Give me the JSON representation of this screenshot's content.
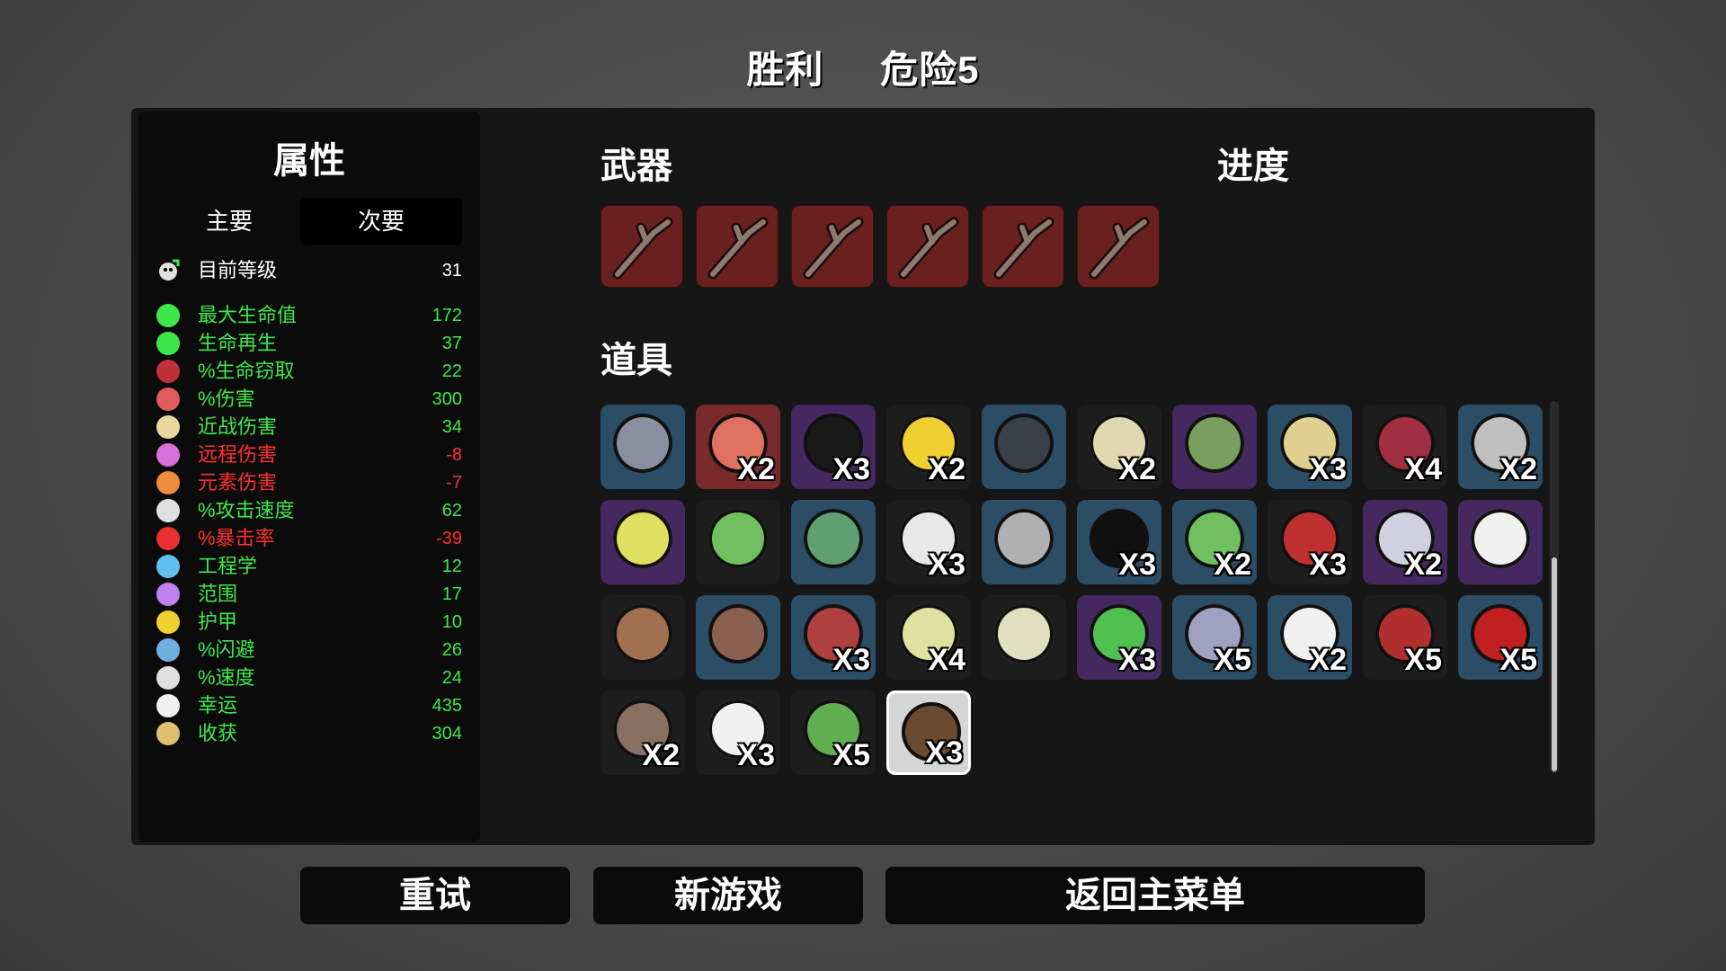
{
  "header": {
    "result": "胜利",
    "danger": "危险5"
  },
  "stats": {
    "title": "属性",
    "tabs": {
      "primary": "主要",
      "secondary": "次要"
    },
    "level": {
      "label": "目前等级",
      "value": "31"
    },
    "rows": [
      {
        "label": "最大生命值",
        "value": "172",
        "tone": "green",
        "icon": "heart-icon",
        "color": "#3fe84a"
      },
      {
        "label": "生命再生",
        "value": "37",
        "tone": "green",
        "icon": "heart-plus-icon",
        "color": "#3fe84a"
      },
      {
        "label": "%生命窃取",
        "value": "22",
        "tone": "green",
        "icon": "fangs-icon",
        "color": "#c0303a"
      },
      {
        "label": "%伤害",
        "value": "300",
        "tone": "green",
        "icon": "muscle-icon",
        "color": "#e05b5b"
      },
      {
        "label": "近战伤害",
        "value": "34",
        "tone": "green",
        "icon": "sword-icon",
        "color": "#e8d8a0"
      },
      {
        "label": "远程伤害",
        "value": "-8",
        "tone": "red",
        "icon": "bow-icon",
        "color": "#d870d8"
      },
      {
        "label": "元素伤害",
        "value": "-7",
        "tone": "red",
        "icon": "flame-icon",
        "color": "#f08a3c"
      },
      {
        "label": "%攻击速度",
        "value": "62",
        "tone": "green",
        "icon": "hourglass-icon",
        "color": "#e0e0e0"
      },
      {
        "label": "%暴击率",
        "value": "-39",
        "tone": "red",
        "icon": "crit-burst-icon",
        "color": "#e83030"
      },
      {
        "label": "工程学",
        "value": "12",
        "tone": "green",
        "icon": "wrench-icon",
        "color": "#60c0f0"
      },
      {
        "label": "范围",
        "value": "17",
        "tone": "green",
        "icon": "range-icon",
        "color": "#c080f0"
      },
      {
        "label": "护甲",
        "value": "10",
        "tone": "green",
        "icon": "shield-icon",
        "color": "#f0d030"
      },
      {
        "label": "%闪避",
        "value": "26",
        "tone": "green",
        "icon": "dodge-icon",
        "color": "#70b0e0"
      },
      {
        "label": "%速度",
        "value": "24",
        "tone": "green",
        "icon": "boot-icon",
        "color": "#e0e0e0"
      },
      {
        "label": "幸运",
        "value": "435",
        "tone": "green",
        "icon": "dice-icon",
        "color": "#f0f0f0"
      },
      {
        "label": "收获",
        "value": "304",
        "tone": "green",
        "icon": "wheat-icon",
        "color": "#e0c070"
      }
    ]
  },
  "weapons": {
    "title": "武器",
    "slots": [
      {
        "icon": "stick-icon"
      },
      {
        "icon": "stick-icon"
      },
      {
        "icon": "stick-icon"
      },
      {
        "icon": "stick-icon"
      },
      {
        "icon": "stick-icon"
      },
      {
        "icon": "stick-icon"
      }
    ]
  },
  "progress": {
    "title": "进度"
  },
  "items": {
    "title": "道具",
    "slots": [
      {
        "icon": "stone-ring-icon",
        "tier": "blue",
        "count": "",
        "color": "#8a8fa0"
      },
      {
        "icon": "octopus-icon",
        "tier": "red",
        "count": "X2",
        "color": "#e07060"
      },
      {
        "icon": "bowler-hat-icon",
        "tier": "purple",
        "count": "X3",
        "color": "#1a1a1a"
      },
      {
        "icon": "duck-icon",
        "tier": "black",
        "count": "X2",
        "color": "#f0d030"
      },
      {
        "icon": "jellyfish-robot-icon",
        "tier": "blue",
        "count": "",
        "color": "#3a3f4a"
      },
      {
        "icon": "scroll-icon",
        "tier": "black",
        "count": "X2",
        "color": "#e0d8b0"
      },
      {
        "icon": "tractor-icon",
        "tier": "purple",
        "count": "",
        "color": "#7aa060"
      },
      {
        "icon": "lasso-icon",
        "tier": "blue",
        "count": "X3",
        "color": "#e0d090"
      },
      {
        "icon": "serpent-icon",
        "tier": "black",
        "count": "X4",
        "color": "#a03040"
      },
      {
        "icon": "blade-icon",
        "tier": "blue",
        "count": "X2",
        "color": "#c0c0c0"
      },
      {
        "icon": "chemistry-set-icon",
        "tier": "purple",
        "count": "",
        "color": "#e0e060"
      },
      {
        "icon": "sprout-icon",
        "tier": "black",
        "count": "",
        "color": "#70c060"
      },
      {
        "icon": "machine-icon",
        "tier": "blue",
        "count": "",
        "color": "#60a070"
      },
      {
        "icon": "bandaged-head-icon",
        "tier": "black",
        "count": "X3",
        "color": "#e8e8e8"
      },
      {
        "icon": "factory-icon",
        "tier": "blue",
        "count": "",
        "color": "#b0b0b0"
      },
      {
        "icon": "black-orbs-icon",
        "tier": "blue",
        "count": "X3",
        "color": "#101010"
      },
      {
        "icon": "frog-icon",
        "tier": "blue",
        "count": "X2",
        "color": "#70c060"
      },
      {
        "icon": "red-lizard-icon",
        "tier": "black",
        "count": "X3",
        "color": "#c03030"
      },
      {
        "icon": "cannon-icon",
        "tier": "purple",
        "count": "X2",
        "color": "#d0d0e0"
      },
      {
        "icon": "ghost-cat-icon",
        "tier": "purple",
        "count": "",
        "color": "#f0f0f0"
      },
      {
        "icon": "monkey-icon",
        "tier": "black",
        "count": "",
        "color": "#a07050"
      },
      {
        "icon": "vest-icon",
        "tier": "blue",
        "count": "",
        "color": "#8a6050"
      },
      {
        "icon": "tentacle-icon",
        "tier": "blue",
        "count": "X3",
        "color": "#b04040"
      },
      {
        "icon": "bucket-icon",
        "tier": "black",
        "count": "X4",
        "color": "#e0e0a0"
      },
      {
        "icon": "lizard-icon",
        "tier": "black",
        "count": "",
        "color": "#e0e0c0"
      },
      {
        "icon": "clover-icon",
        "tier": "purple",
        "count": "X3",
        "color": "#50c050"
      },
      {
        "icon": "alarm-robot-icon",
        "tier": "blue",
        "count": "X5",
        "color": "#a0a0c0"
      },
      {
        "icon": "drone-icon",
        "tier": "blue",
        "count": "X2",
        "color": "#f0f0f0"
      },
      {
        "icon": "bloody-hand-icon",
        "tier": "black",
        "count": "X5",
        "color": "#b03030"
      },
      {
        "icon": "red-cape-icon",
        "tier": "blue",
        "count": "X5",
        "color": "#c02020"
      },
      {
        "icon": "scythe-icon",
        "tier": "black",
        "count": "X2",
        "color": "#8a7060"
      },
      {
        "icon": "fang-icon",
        "tier": "black",
        "count": "X3",
        "color": "#f0f0f0"
      },
      {
        "icon": "tree-icon",
        "tier": "black",
        "count": "X5",
        "color": "#60b050"
      },
      {
        "icon": "sack-icon",
        "tier": "white",
        "count": "X3",
        "color": "#6a4a30"
      }
    ]
  },
  "buttons": {
    "retry": "重试",
    "new_game": "新游戏",
    "main_menu": "返回主菜单"
  }
}
